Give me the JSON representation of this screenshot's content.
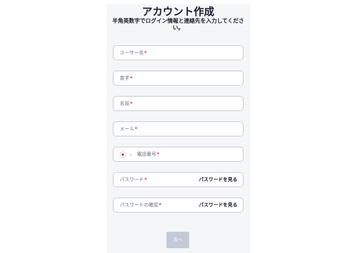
{
  "form": {
    "title": "アカウント作成",
    "subtitle": "半角英数字でログイン情報と連絡先を入力してください。",
    "required_mark": "*",
    "fields": {
      "username": {
        "label": "ユーザー名"
      },
      "last_name": {
        "label": "苗字"
      },
      "first_name": {
        "label": "名前"
      },
      "email": {
        "label": "メール"
      },
      "phone": {
        "label": "電話番号",
        "country": "JP",
        "country_icon": "japan-flag-icon",
        "dropdown_icon": "chevron-down-icon"
      },
      "password": {
        "label": "パスワード",
        "toggle_label": "パスワードを見る"
      },
      "password_confirm": {
        "label": "パスワードの確認",
        "toggle_label": "パスワードを見る"
      }
    },
    "next_label": "次へ"
  },
  "colors": {
    "panel_background": "#f5f6f8",
    "required": "#d02a3c",
    "button_disabled": "#c3c9d6",
    "title_text": "#1a1a33"
  }
}
